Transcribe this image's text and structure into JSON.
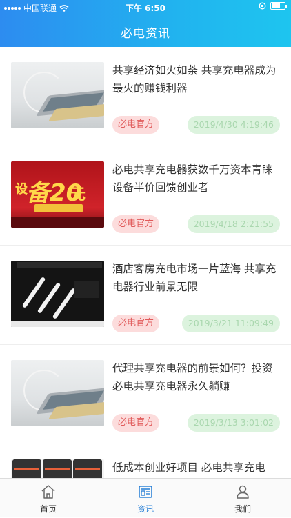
{
  "status_bar": {
    "carrier": "中国联通",
    "time": "下午 6:50"
  },
  "header": {
    "title": "必电资讯"
  },
  "articles": [
    {
      "title": "共享经济如火如荼 共享充电器成为最火的赚钱利器",
      "tag": "必电官方",
      "date": "2019/4/30 4:19:46",
      "thumb": "phones-charging-photo"
    },
    {
      "title": "必电共享充电器获数千万资本青睐 设备半价回馈创业者",
      "tag": "必电官方",
      "date": "2019/4/18 2:21:55",
      "thumb": "red-promo-banner"
    },
    {
      "title": "酒店客房充电市场一片蓝海 共享充电器行业前景无限",
      "tag": "必电官方",
      "date": "2019/3/21 11:09:49",
      "thumb": "charging-cables-photo"
    },
    {
      "title": "代理共享充电器的前景如何？投资必电共享充电器永久躺赚",
      "tag": "必电官方",
      "date": "2019/3/13 3:01:02",
      "thumb": "phones-charging-photo"
    },
    {
      "title": "低成本创业好项目 必电共享充电",
      "thumb": "app-screens-photo"
    }
  ],
  "tabbar": {
    "items": [
      {
        "label": "首页",
        "icon": "home-icon"
      },
      {
        "label": "资讯",
        "icon": "news-icon",
        "active": true
      },
      {
        "label": "我们",
        "icon": "user-icon"
      }
    ]
  },
  "colors": {
    "header_gradient_start": "#2d8cf0",
    "header_gradient_end": "#1ec5ef",
    "tag_bg": "#fcdcdc",
    "tag_text": "#e05a5a",
    "date_bg": "#dcf3de",
    "date_text": "#a9d7ae",
    "tab_active": "#2f84d8"
  }
}
